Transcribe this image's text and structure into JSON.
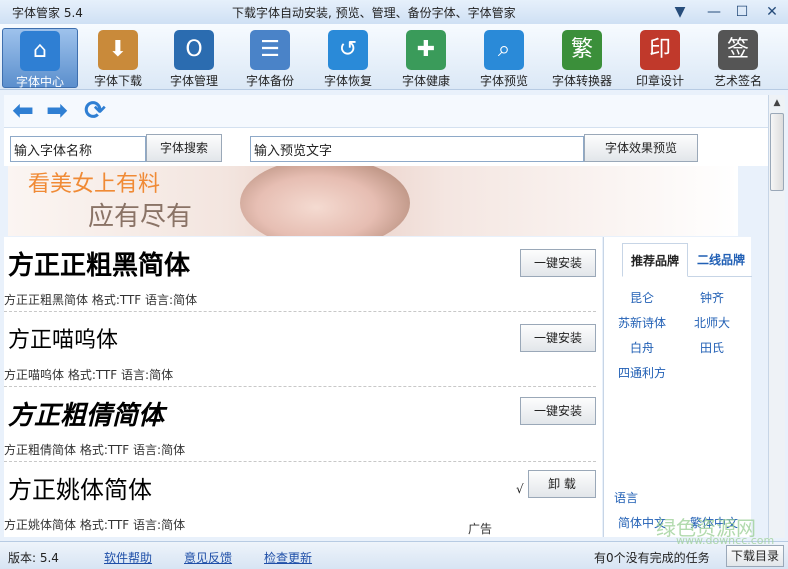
{
  "window": {
    "title": "字体管家 5.4",
    "subtitle": "下载字体自动安装, 预览、管理、备份字体、字体管家",
    "controls": [
      "▼",
      "—",
      "☐",
      "✕"
    ]
  },
  "toolbar": {
    "items": [
      {
        "label": "字体中心",
        "icon": "home-icon",
        "glyph": "⌂",
        "color": "#2f7fd3"
      },
      {
        "label": "字体下载",
        "icon": "download-box-icon",
        "glyph": "⬇",
        "color": "#c98a3a"
      },
      {
        "label": "字体管理",
        "icon": "font-manage-icon",
        "glyph": "O",
        "color": "#2b6cb0"
      },
      {
        "label": "字体备份",
        "icon": "document-backup-icon",
        "glyph": "☰",
        "color": "#4a83c8"
      },
      {
        "label": "字体恢复",
        "icon": "restore-icon",
        "glyph": "↺",
        "color": "#2a8ad8"
      },
      {
        "label": "字体健康",
        "icon": "health-kit-icon",
        "glyph": "✚",
        "color": "#3a9b5a"
      },
      {
        "label": "字体预览",
        "icon": "magnifier-icon",
        "glyph": "⌕",
        "color": "#2a8ad8"
      },
      {
        "label": "字体转换器",
        "icon": "converter-icon",
        "glyph": "繁",
        "color": "#3b8f3a"
      },
      {
        "label": "印章设计",
        "icon": "seal-icon",
        "glyph": "印",
        "color": "#c0392b"
      },
      {
        "label": "艺术签名",
        "icon": "signature-icon",
        "glyph": "签",
        "color": "#555555"
      }
    ],
    "active_index": 0
  },
  "nav": {
    "back_glyph": "⬅",
    "forward_glyph": "➡",
    "refresh_glyph": "⟳"
  },
  "search": {
    "font_name_value": "输入字体名称",
    "search_button": "字体搜索",
    "preview_text_value": "输入预览文字",
    "preview_button": "字体效果预览"
  },
  "banner": {
    "line1": "看美女上有料",
    "line2": "应有尽有"
  },
  "fonts": [
    {
      "sample": "方正正粗黑简体",
      "meta": "方正正粗黑简体  格式:TTF 语言:简体",
      "action": "一键安装",
      "bold": true
    },
    {
      "sample": "方正喵呜体",
      "meta": "方正喵呜体  格式:TTF 语言:简体",
      "action": "一键安装",
      "bold": false
    },
    {
      "sample": "方正粗倩简体",
      "meta": "方正粗倩简体  格式:TTF 语言:简体",
      "action": "一键安装",
      "bold": true
    },
    {
      "sample": "方正姚体简体",
      "meta": "方正姚体简体  格式:TTF 语言:简体",
      "action": "卸 载",
      "bold": false,
      "installed_mark": "√"
    }
  ],
  "ad_label": "广告",
  "side": {
    "tab_active": "推荐品牌",
    "tab_other": "二线品牌",
    "brands": [
      "昆仑",
      "钟齐",
      "苏新诗体",
      "北师大",
      "白舟",
      "田氏",
      "四通利方"
    ],
    "language_heading": "语言",
    "languages": [
      "简体中文",
      "繁体中文"
    ]
  },
  "statusbar": {
    "version": "版本: 5.4",
    "help": "软件帮助",
    "feedback": "意见反馈",
    "update": "检查更新",
    "tasks": "有0个没有完成的任务",
    "download_dir": "下载目录"
  },
  "watermark": {
    "text": "绿色资源网",
    "sub": "www.downcc.com"
  }
}
